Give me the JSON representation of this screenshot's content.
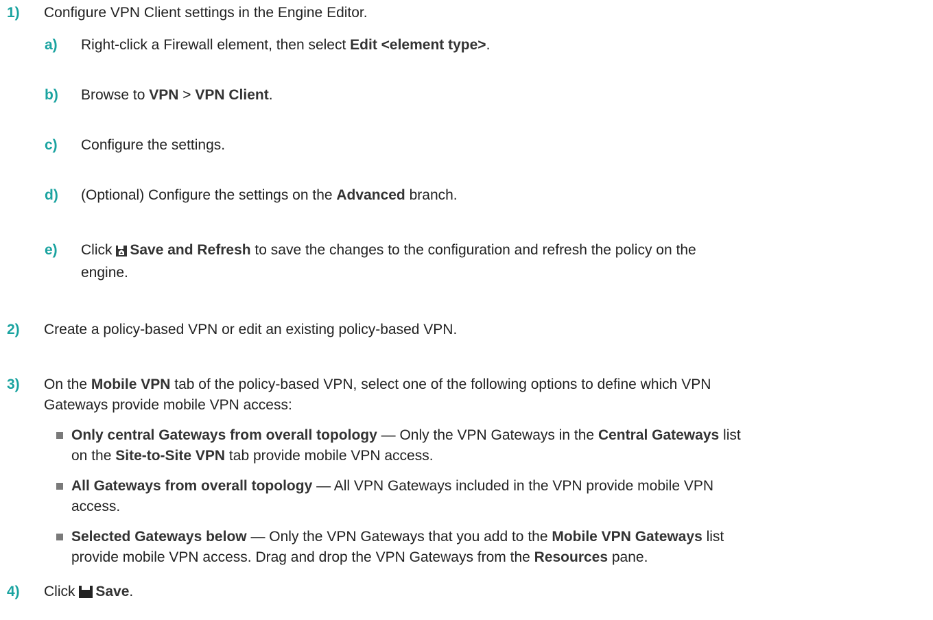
{
  "steps": [
    {
      "num": "1)",
      "text": "Configure VPN Client settings in the Engine Editor.",
      "substeps": [
        {
          "num": "a)",
          "pre": "Right-click a Firewall element, then select ",
          "bold": "Edit <element type>",
          "post": "."
        },
        {
          "num": "b)",
          "pre": "Browse to ",
          "bold1": "VPN",
          "mid": " > ",
          "bold2": "VPN Client",
          "post": "."
        },
        {
          "num": "c)",
          "text": "Configure the settings."
        },
        {
          "num": "d)",
          "pre": "(Optional) Configure the settings on the ",
          "bold": "Advanced",
          "post": " branch."
        },
        {
          "num": "e)",
          "pre": "Click ",
          "icon": "save-refresh-icon",
          "bold": "Save and Refresh",
          "post": " to save the changes to the configuration and refresh the policy on the",
          "line2": "engine."
        }
      ]
    },
    {
      "num": "2)",
      "text": "Create a policy-based VPN or edit an existing policy-based VPN."
    },
    {
      "num": "3)",
      "pre": "On the ",
      "bold": "Mobile VPN",
      "post": " tab of the policy-based VPN, select one of the following options to define which VPN",
      "line2": "Gateways provide mobile VPN access:",
      "bullets": [
        {
          "bold": "Only central Gateways from overall topology",
          "text1": " — Only the VPN Gateways in the ",
          "bold2": "Central Gateways",
          "text2": " list",
          "line2_pre": "on the ",
          "line2_bold": "Site-to-Site VPN",
          "line2_post": " tab provide mobile VPN access."
        },
        {
          "bold": "All Gateways from overall topology",
          "text1": " — All VPN Gateways included in the VPN provide mobile VPN",
          "line2": "access."
        },
        {
          "bold": "Selected Gateways below",
          "text1": " — Only the VPN Gateways that you add to the ",
          "bold2": "Mobile VPN Gateways",
          "text2": " list",
          "line2_pre": "provide mobile VPN access. Drag and drop the VPN Gateways from the ",
          "line2_bold": "Resources",
          "line2_post": " pane."
        }
      ]
    },
    {
      "num": "4)",
      "pre": "Click ",
      "icon": "save-icon",
      "bold": "Save",
      "post": "."
    }
  ]
}
